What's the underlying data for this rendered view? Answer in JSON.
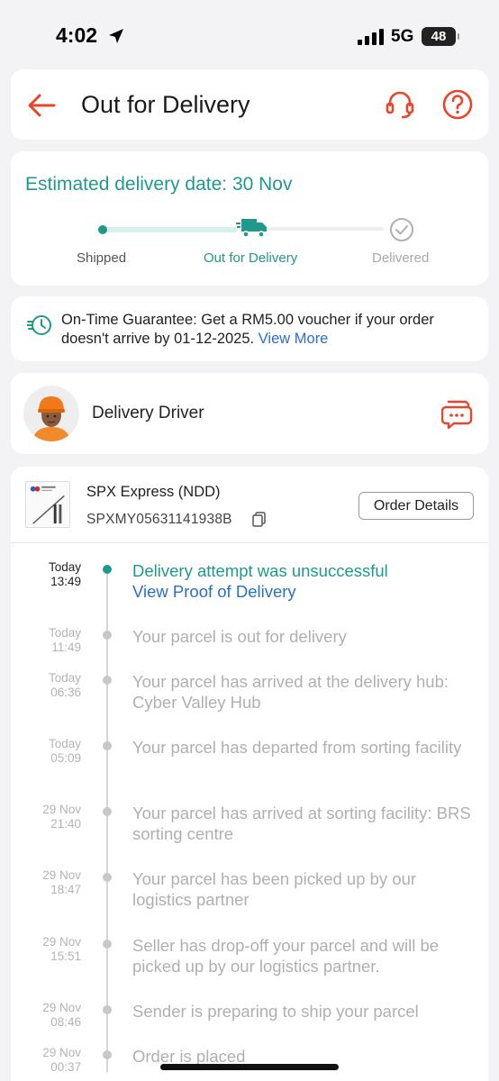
{
  "status_bar": {
    "time": "4:02",
    "network": "5G",
    "battery": "48"
  },
  "header": {
    "title": "Out for Delivery",
    "icons": [
      "back-arrow-icon",
      "headset-icon",
      "help-icon"
    ]
  },
  "progress": {
    "estimated": "Estimated delivery date: 30 Nov",
    "steps": [
      "Shipped",
      "Out for Delivery",
      "Delivered"
    ],
    "current_step": 1
  },
  "guarantee": {
    "text": "On-Time Guarantee: Get a RM5.00 voucher if your order doesn't arrive by 01-12-2025.",
    "link": "View More"
  },
  "driver": {
    "label": "Delivery Driver"
  },
  "shipment": {
    "courier": "SPX Express (NDD)",
    "tracking_number": "SPXMY05631141938B",
    "order_details_label": "Order Details"
  },
  "events": [
    {
      "day": "Today",
      "time": "13:49",
      "text": "Delivery attempt was unsuccessful",
      "link": "View Proof of Delivery",
      "active": true
    },
    {
      "day": "Today",
      "time": "11:49",
      "text": "Your parcel is out for delivery"
    },
    {
      "day": "Today",
      "time": "06:36",
      "text": "Your parcel has arrived at the delivery hub: Cyber Valley Hub"
    },
    {
      "day": "Today",
      "time": "05:09",
      "text": "Your parcel has departed from sorting facility"
    },
    {
      "day": "29 Nov",
      "time": "21:40",
      "text": "Your parcel has arrived at sorting facility: BRS sorting centre"
    },
    {
      "day": "29 Nov",
      "time": "18:47",
      "text": "Your parcel has been picked up by our logistics partner"
    },
    {
      "day": "29 Nov",
      "time": "15:51",
      "text": "Seller has drop-off your parcel and will be picked up by our logistics partner."
    },
    {
      "day": "29 Nov",
      "time": "08:46",
      "text": "Sender is preparing to ship your parcel"
    },
    {
      "day": "29 Nov",
      "time": "00:37",
      "text": "Order is placed"
    }
  ],
  "colors": {
    "accent": "#1f9a8a",
    "brand": "#e8452c",
    "link": "#2a6fc9"
  }
}
